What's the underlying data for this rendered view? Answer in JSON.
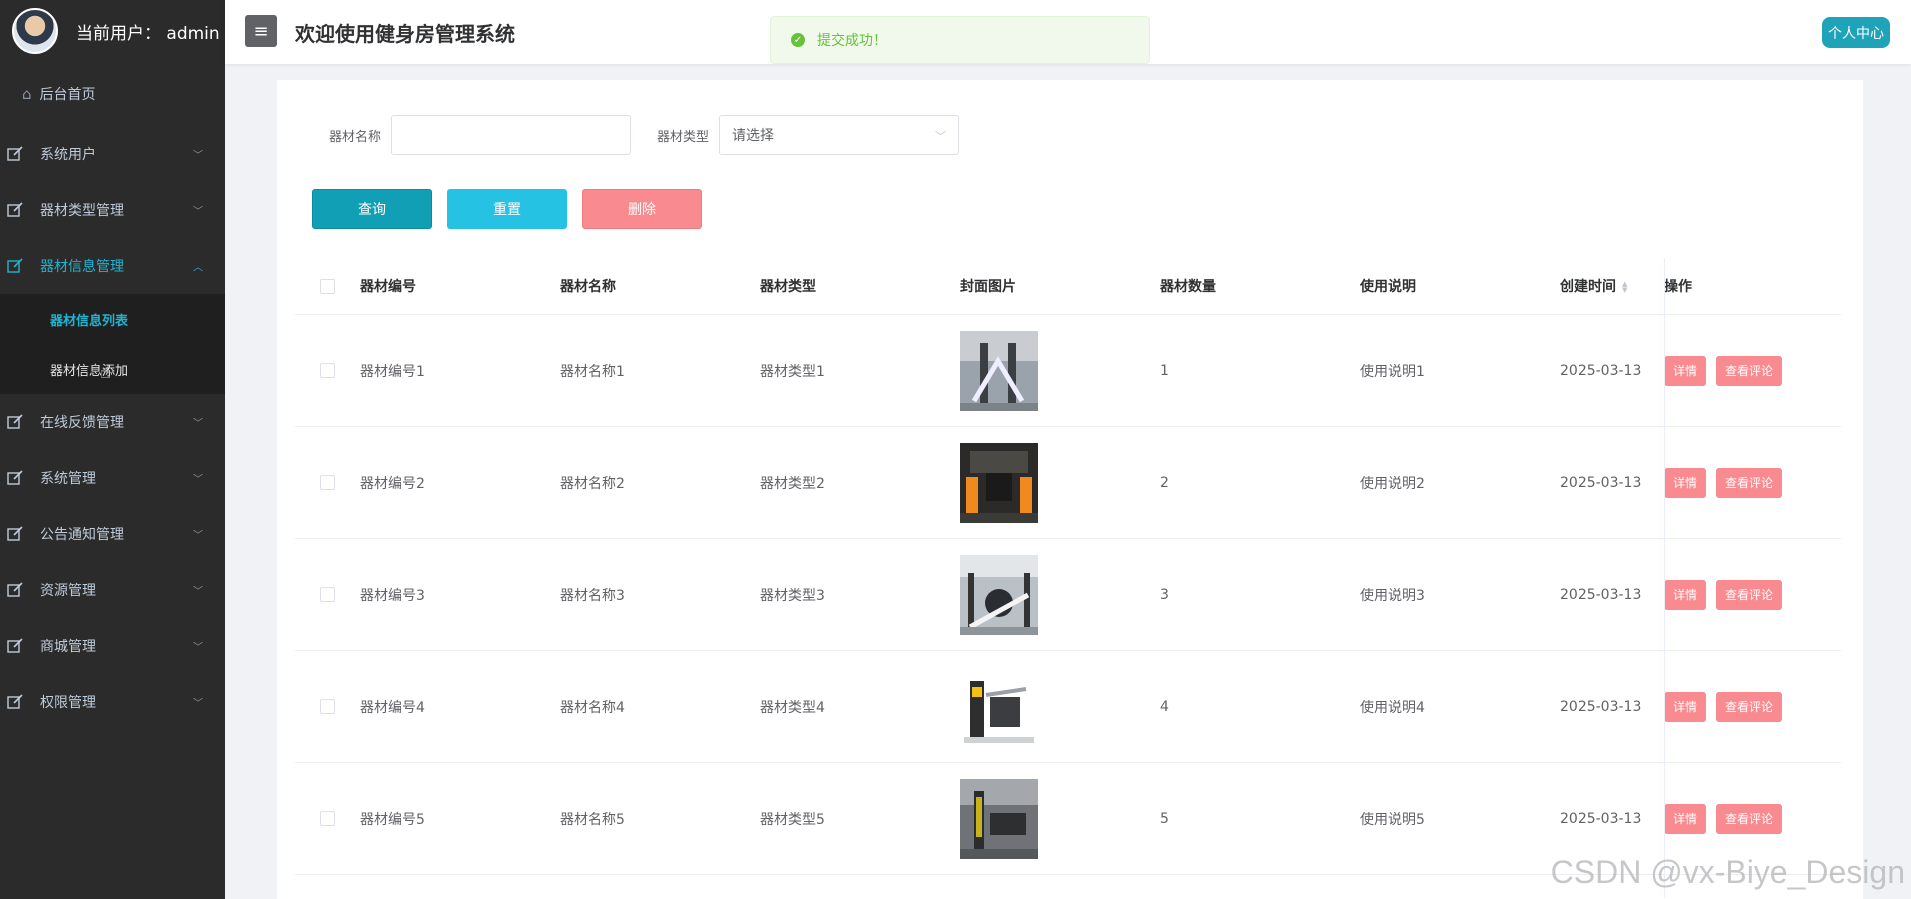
{
  "sidebar": {
    "user_label": "当前用户：  admin",
    "home_label": "后台首页",
    "items": [
      {
        "label": "系统用户",
        "icon": "edit-icon"
      },
      {
        "label": "器材类型管理",
        "icon": "edit-icon"
      },
      {
        "label": "器材信息管理",
        "icon": "edit-icon",
        "active": true
      },
      {
        "label": "在线反馈管理",
        "icon": "edit-icon"
      },
      {
        "label": "系统管理",
        "icon": "edit-icon"
      },
      {
        "label": "公告通知管理",
        "icon": "edit-icon"
      },
      {
        "label": "资源管理",
        "icon": "edit-icon"
      },
      {
        "label": "商城管理",
        "icon": "edit-icon"
      },
      {
        "label": "权限管理",
        "icon": "edit-icon"
      }
    ],
    "submenu": [
      {
        "label": "器材信息列表",
        "active": true
      },
      {
        "label": "器材信息添加"
      }
    ]
  },
  "header": {
    "title": "欢迎使用健身房管理系统",
    "profile_label": "个人中心"
  },
  "toast": {
    "message": "提交成功！"
  },
  "search": {
    "name_label": "器材名称",
    "name_value": "",
    "type_label": "器材类型",
    "type_placeholder": "请选择"
  },
  "buttons": {
    "query": "查询",
    "reset": "重置",
    "delete": "删除"
  },
  "table": {
    "headers": [
      "器材编号",
      "器材名称",
      "器材类型",
      "封面图片",
      "器材数量",
      "使用说明",
      "创建时间",
      "操作"
    ],
    "rows": [
      {
        "code": "器材编号1",
        "name": "器材名称1",
        "type": "器材类型1",
        "qty": "1",
        "desc": "使用说明1",
        "time": "2025-03-13"
      },
      {
        "code": "器材编号2",
        "name": "器材名称2",
        "type": "器材类型2",
        "qty": "2",
        "desc": "使用说明2",
        "time": "2025-03-13"
      },
      {
        "code": "器材编号3",
        "name": "器材名称3",
        "type": "器材类型3",
        "qty": "3",
        "desc": "使用说明3",
        "time": "2025-03-13"
      },
      {
        "code": "器材编号4",
        "name": "器材名称4",
        "type": "器材类型4",
        "qty": "4",
        "desc": "使用说明4",
        "time": "2025-03-13"
      },
      {
        "code": "器材编号5",
        "name": "器材名称5",
        "type": "器材类型5",
        "qty": "5",
        "desc": "使用说明5",
        "time": "2025-03-13"
      }
    ],
    "detail_label": "详情",
    "comment_label": "查看评论"
  },
  "watermark": "CSDN @vx-Biye_Design",
  "colors": {
    "accent": "#1fb5d2",
    "danger_soft": "#f98a8f",
    "sidebar_bg": "#2b2b2b"
  }
}
